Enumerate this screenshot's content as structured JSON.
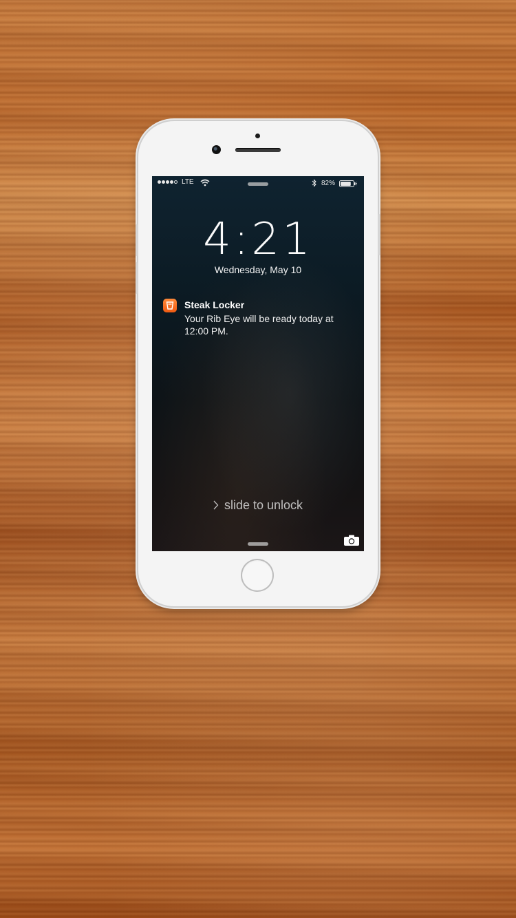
{
  "status_bar": {
    "signal_dots": 5,
    "signal_filled": 4,
    "carrier": "LTE",
    "battery_percent": "82%",
    "battery_level": 0.82,
    "icons": [
      "wifi-icon",
      "bluetooth-icon",
      "battery-icon",
      "charging-bolt-icon"
    ]
  },
  "lock_screen": {
    "time": "4:21",
    "date": "Wednesday, May 10",
    "slide_to_unlock": "slide to unlock",
    "camera_icon": "camera-icon"
  },
  "notification": {
    "app_name": "Steak Locker",
    "message": "Your Rib Eye will be ready today at 12:00 PM.",
    "app_icon": "steak-locker-app-icon",
    "accent_color": "#f26a1b"
  },
  "colors": {
    "phone_body": "#f4f4f4",
    "screen_top": "#0f2330",
    "screen_bottom": "#1b1617",
    "wood": "#b8662a"
  }
}
